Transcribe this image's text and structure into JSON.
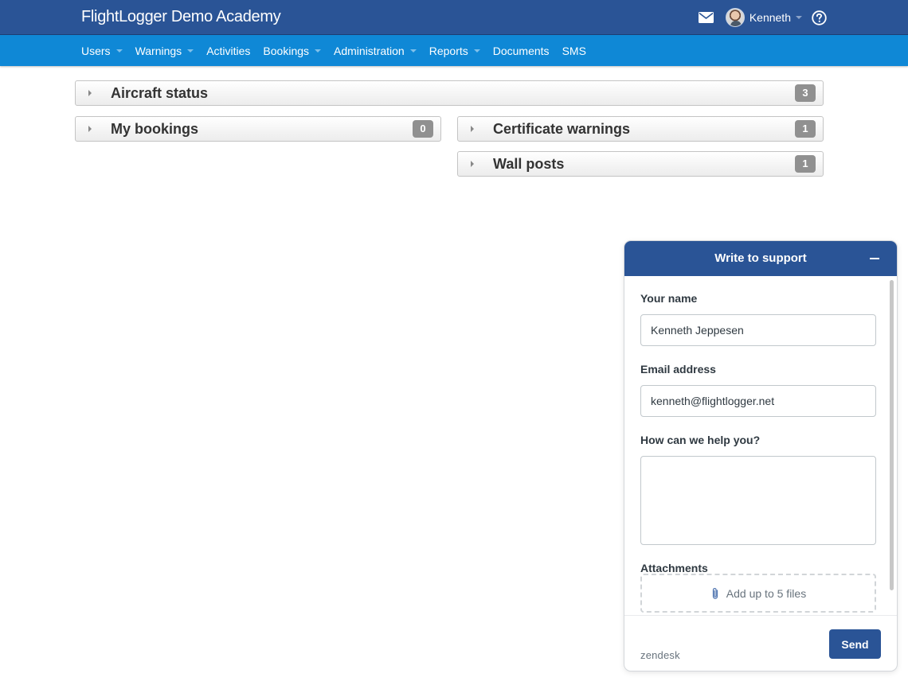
{
  "header": {
    "brand": "FlightLogger Demo Academy",
    "user_name": "Kenneth",
    "icons": [
      "envelope-icon",
      "avatar",
      "question-circle-icon"
    ]
  },
  "nav": {
    "items": [
      {
        "label": "Users",
        "dropdown": true
      },
      {
        "label": "Warnings",
        "dropdown": true
      },
      {
        "label": "Activities",
        "dropdown": false
      },
      {
        "label": "Bookings",
        "dropdown": true
      },
      {
        "label": "Administration",
        "dropdown": true
      },
      {
        "label": "Reports",
        "dropdown": true
      },
      {
        "label": "Documents",
        "dropdown": false
      },
      {
        "label": "SMS",
        "dropdown": false
      }
    ]
  },
  "panels": {
    "aircraft_status": {
      "title": "Aircraft status",
      "count": "3"
    },
    "my_bookings": {
      "title": "My bookings",
      "count": "0"
    },
    "certificate_warnings": {
      "title": "Certificate warnings",
      "count": "1"
    },
    "wall_posts": {
      "title": "Wall posts",
      "count": "1"
    }
  },
  "support_widget": {
    "title": "Write to support",
    "name_label": "Your name",
    "name_value": "Kenneth Jeppesen",
    "email_label": "Email address",
    "email_value": "kenneth@flightlogger.net",
    "message_label": "How can we help you?",
    "message_value": "",
    "attachments_label": "Attachments",
    "attachments_hint": "Add up to 5 files",
    "branding": "zendesk",
    "send_label": "Send"
  },
  "colors": {
    "header_bg": "#2a5496",
    "nav_bg": "#0f88d6",
    "badge_bg": "#909090",
    "button_bg": "#2a5496"
  }
}
